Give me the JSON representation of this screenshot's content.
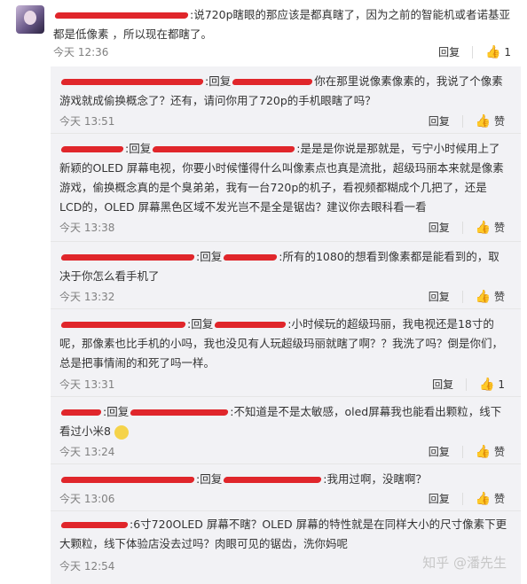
{
  "main": {
    "text": ":说720p瞎眼的那应该是都真瞎了，因为之前的智能机或者诺基亚都是低像素 ，所以现在都瞎了。",
    "time": "今天 12:36",
    "reply_label": "回复",
    "like_count": "1"
  },
  "replies": [
    {
      "reply_word": "回复",
      "text_a": "你在那里说像素像素的，我说了个像素游戏就成偷换概念了？还有，请问你用了720p的手机眼瞎了吗？",
      "time": "今天 13:51",
      "reply_label": "回复",
      "like_label": "赞"
    },
    {
      "prefix": ":",
      "reply_word": "回复",
      "text_a": ":是是是你说是那就是，亏宁小时候用上了新颖的OLED 屏幕电视，你要小时候懂得什么叫像素点也真是流批，超级玛丽本来就是像素游戏，偷换概念真的是个臭弟弟，我有一台720p的机子，看视频都糊成个几把了，还是LCD的，OLED 屏幕黑色区域不发光岂不是全是锯齿？建议你去眼科看一看",
      "time": "今天 13:38",
      "reply_label": "回复",
      "like_label": "赞"
    },
    {
      "prefix": ":",
      "reply_word": "回复",
      "text_a": ":所有的1080的想看到像素都是能看到的，取决于你怎么看手机了",
      "time": "今天 13:32",
      "reply_label": "回复",
      "like_label": "赞"
    },
    {
      "prefix": ":",
      "reply_word": "回复",
      "text_a": ":小时候玩的超级玛丽，我电视还是18寸的呢，那像素也比手机的小吗，我也没见有人玩超级玛丽就瞎了啊？？我洗了吗？倒是你们，总是把事情闹的和死了吗一样。",
      "time": "今天 13:31",
      "reply_label": "回复",
      "like_count": "1"
    },
    {
      "prefix": ":",
      "reply_word": "回复",
      "text_a": ":不知道是不是太敏感，oled屏幕我也能看出颗粒，线下看过小米8",
      "time": "今天 13:24",
      "reply_label": "回复",
      "like_label": "赞"
    },
    {
      "prefix": ":",
      "reply_word": "回复",
      "text_a": ":我用过啊，没瞎啊？",
      "time": "今天 13:06",
      "reply_label": "回复",
      "like_label": "赞"
    },
    {
      "text_a": ":6寸720OLED 屏幕不瞎？OLED 屏幕的特性就是在同样大小的尺寸像素下更大颗粒，线下体验店没去过吗？肉眼可见的锯齿，洗你妈呢",
      "time": "今天 12:54"
    }
  ],
  "watermark": "知乎 @潘先生",
  "colors": {
    "redact": "#e0262b",
    "inner_bg": "#f2f2f5",
    "meta": "#808080"
  }
}
